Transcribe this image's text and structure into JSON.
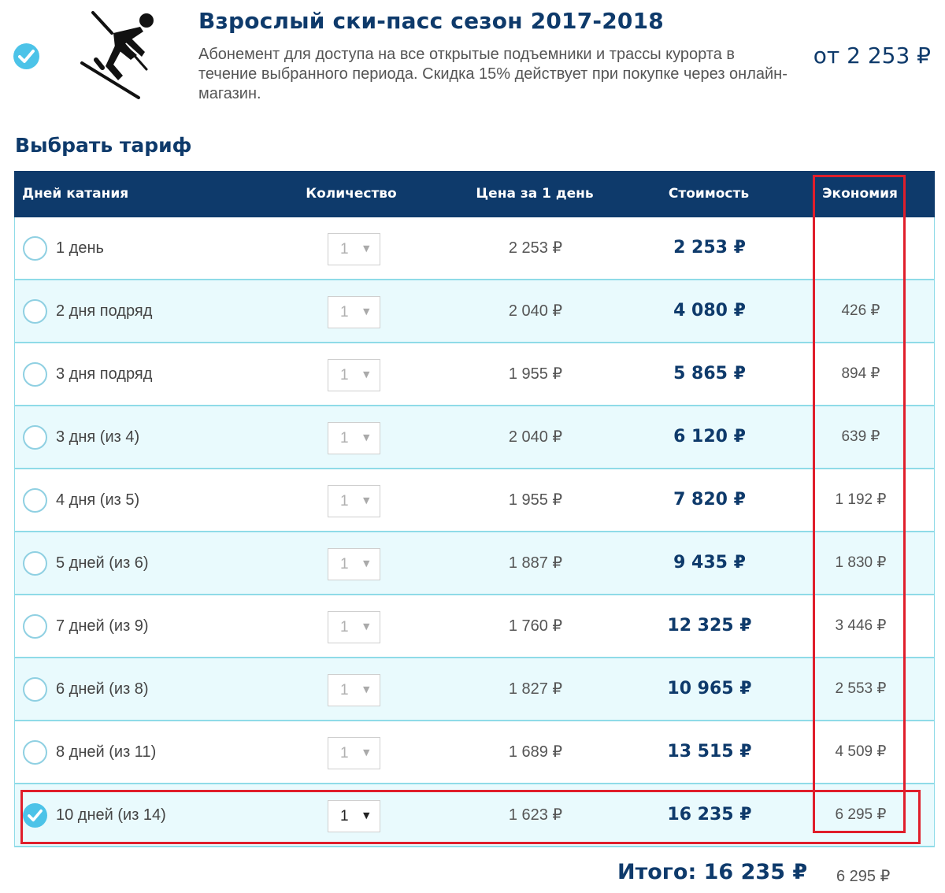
{
  "product": {
    "title": "Взрослый ски-пасс сезон 2017-2018",
    "description": "Абонемент для доступа на все открытые подъемники и трассы курорта в течение выбранного периода. Скидка 15% действует при покупке через онлайн-магазин.",
    "price": "от 2 253 ₽",
    "icon": "skier-icon",
    "selected": true
  },
  "section_title": "Выбрать тариф",
  "table": {
    "headers": {
      "days": "Дней катания",
      "quantity": "Количество",
      "price_per_day": "Цена за 1 день",
      "cost": "Стоимость",
      "savings": "Экономия"
    },
    "rows": [
      {
        "days": "1 день",
        "qty": "1",
        "price": "2 253 ₽",
        "cost": "2 253 ₽",
        "savings": "",
        "selected": false
      },
      {
        "days": "2 дня подряд",
        "qty": "1",
        "price": "2 040 ₽",
        "cost": "4 080 ₽",
        "savings": "426 ₽",
        "selected": false
      },
      {
        "days": "3 дня подряд",
        "qty": "1",
        "price": "1 955 ₽",
        "cost": "5 865 ₽",
        "savings": "894 ₽",
        "selected": false
      },
      {
        "days": "3 дня (из 4)",
        "qty": "1",
        "price": "2 040 ₽",
        "cost": "6 120 ₽",
        "savings": "639 ₽",
        "selected": false
      },
      {
        "days": "4 дня (из 5)",
        "qty": "1",
        "price": "1 955 ₽",
        "cost": "7 820 ₽",
        "savings": "1 192 ₽",
        "selected": false
      },
      {
        "days": "5 дней (из 6)",
        "qty": "1",
        "price": "1 887 ₽",
        "cost": "9 435 ₽",
        "savings": "1 830 ₽",
        "selected": false
      },
      {
        "days": "7 дней (из 9)",
        "qty": "1",
        "price": "1 760 ₽",
        "cost": "12 325 ₽",
        "savings": "3 446 ₽",
        "selected": false
      },
      {
        "days": "6 дней (из 8)",
        "qty": "1",
        "price": "1 827 ₽",
        "cost": "10 965 ₽",
        "savings": "2 553 ₽",
        "selected": false
      },
      {
        "days": "8 дней (из 11)",
        "qty": "1",
        "price": "1 689 ₽",
        "cost": "13 515 ₽",
        "savings": "4 509 ₽",
        "selected": false
      },
      {
        "days": "10 дней (из 14)",
        "qty": "1",
        "price": "1 623 ₽",
        "cost": "16 235 ₽",
        "savings": "6 295 ₽",
        "selected": true
      }
    ]
  },
  "total": {
    "label": "Итого: 16 235 ₽",
    "savings": "6 295 ₽"
  },
  "colors": {
    "header_bg": "#0e3a6b",
    "accent": "#4cc3e8",
    "row_alt": "#e9fafd",
    "border": "#8fdbe8",
    "highlight": "#e01e2b"
  }
}
